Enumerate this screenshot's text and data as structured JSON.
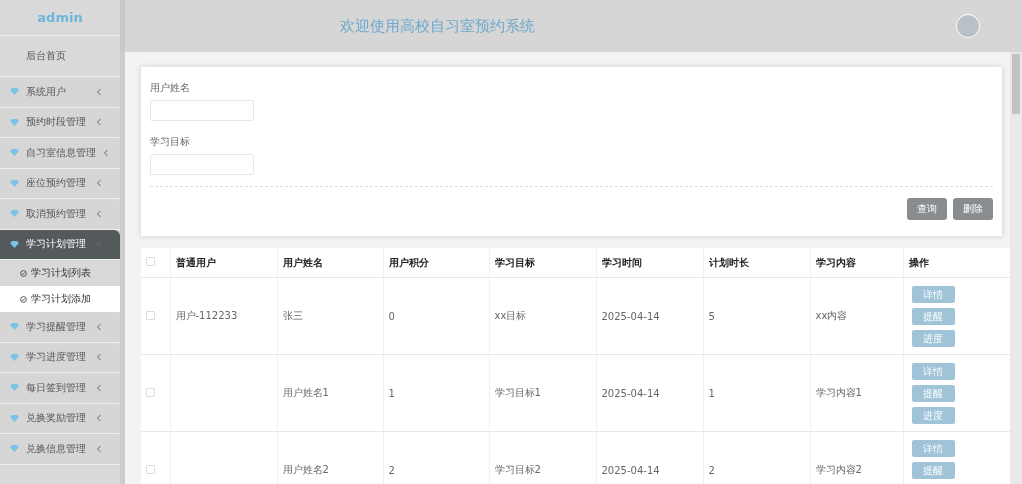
{
  "brand": "admin",
  "header": {
    "title": "欢迎使用高校自习室预约系统"
  },
  "sidebar": {
    "home": "后台首页",
    "items": [
      {
        "label": "系统用户",
        "expanded": false
      },
      {
        "label": "预约时段管理",
        "expanded": false
      },
      {
        "label": "自习室信息管理",
        "expanded": false
      },
      {
        "label": "座位预约管理",
        "expanded": false
      },
      {
        "label": "取消预约管理",
        "expanded": false
      },
      {
        "label": "学习计划管理",
        "expanded": true,
        "children": [
          {
            "label": "学习计划列表",
            "selected": false
          },
          {
            "label": "学习计划添加",
            "selected": true
          }
        ]
      },
      {
        "label": "学习提醒管理",
        "expanded": false
      },
      {
        "label": "学习进度管理",
        "expanded": false
      },
      {
        "label": "每日签到管理",
        "expanded": false
      },
      {
        "label": "兑换奖励管理",
        "expanded": false
      },
      {
        "label": "兑换信息管理",
        "expanded": false
      }
    ]
  },
  "search": {
    "fields": [
      {
        "label": "用户姓名"
      },
      {
        "label": "学习目标"
      }
    ],
    "buttons": [
      "查询",
      "删除"
    ]
  },
  "table": {
    "select_all_checked": false,
    "columns": [
      "普通用户",
      "用户姓名",
      "用户积分",
      "学习目标",
      "学习时间",
      "计划时长",
      "学习内容",
      "操作"
    ],
    "rows": [
      {
        "checked": false,
        "user": "用户-112233",
        "name": "张三",
        "points": "0",
        "goal": "xx目标",
        "time": "2025-04-14",
        "duration": "5",
        "content": "xx内容",
        "actions": [
          "详情",
          "提醒",
          "进度"
        ]
      },
      {
        "checked": false,
        "name": "用户姓名1",
        "points": "1",
        "goal": "学习目标1",
        "time": "2025-04-14",
        "duration": "1",
        "content": "学习内容1",
        "actions": [
          "详情",
          "提醒",
          "进度"
        ]
      },
      {
        "checked": false,
        "name": "用户姓名2",
        "points": "2",
        "goal": "学习目标2",
        "time": "2025-04-14",
        "duration": "2",
        "content": "学习内容2",
        "actions": [
          "详情",
          "提醒"
        ]
      }
    ]
  }
}
